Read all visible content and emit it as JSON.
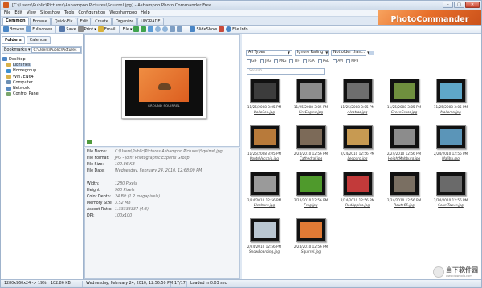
{
  "window": {
    "title": "[C:\\Users\\Public\\Pictures\\Ashampoo Pictures\\Squirrel.jpg] - Ashampoo Photo Commander Free",
    "controls": [
      "–",
      "□",
      "✕"
    ]
  },
  "menu": [
    "File",
    "Edit",
    "View",
    "Slideshow",
    "Tools",
    "Configuration",
    "Webshampoo",
    "Help"
  ],
  "logo_text": "PhotoCommander",
  "ribbon_tabs": [
    "Common",
    "Browse",
    "Quick-Fix",
    "Edit",
    "Create",
    "Organize",
    "UPGRADE"
  ],
  "toolbar": {
    "browse": "Browse",
    "fullscreen": "Fullscreen",
    "save": "Save",
    "print": "Print",
    "email": "Email",
    "file_menu": "File",
    "slideshow": "SlideShow",
    "file_info": "File Info"
  },
  "left_panel": {
    "tabs": [
      "Folders",
      "Calendar"
    ],
    "bookmarks_label": "Bookmarks",
    "path": "C:\\Users\\Public\\Pictures",
    "tree": [
      "Desktop",
      "Libraries",
      "Homegroup",
      "Win7EN64",
      "Computer",
      "Network",
      "Control Panel"
    ]
  },
  "preview": {
    "caption": "GROUND SQUIRREL"
  },
  "file_info": [
    {
      "key": "File Name:",
      "value": "C:\\Users\\Public\\Pictures\\Ashampoo Pictures\\Squirrel.jpg"
    },
    {
      "key": "File Format:",
      "value": "JPG - Joint Photographic Experts Group"
    },
    {
      "key": "File Size:",
      "value": "102.86 KB"
    },
    {
      "key": "File Date:",
      "value": "Wednesday, February 24, 2010, 12:68:00 PM"
    },
    {
      "key": "Width:",
      "value": "1280 Pixels"
    },
    {
      "key": "Height:",
      "value": "960 Pixels"
    },
    {
      "key": "Color Depth:",
      "value": "24 Bit (1.2 megapixels)"
    },
    {
      "key": "Memory Size:",
      "value": "3.52 MB"
    },
    {
      "key": "Aspect Ratio:",
      "value": "1.33333337 (4:3)"
    },
    {
      "key": "DPI:",
      "value": "100x100"
    }
  ],
  "filter": {
    "type": "All Types",
    "rating": "Ignore Rating",
    "age": "Not older than...",
    "formats": [
      "GIF",
      "JPG",
      "PNG",
      "TIF",
      "TGA",
      "PSD",
      "AVI",
      "MP3"
    ],
    "search_placeholder": "Search..."
  },
  "thumbnails": [
    {
      "date": "11/25/2008 3:05 PM",
      "name": "BolloSea.jpg",
      "color": "#3c3c3c"
    },
    {
      "date": "11/25/2008 3:05 PM",
      "name": "FireEngine.jpg",
      "color": "#8c8c8c"
    },
    {
      "date": "11/25/2008 3:05 PM",
      "name": "Alcatraz.jpg",
      "color": "#6e6e6e"
    },
    {
      "date": "11/25/2008 3:05 PM",
      "name": "GreenGrass.jpg",
      "color": "#6f8f3e"
    },
    {
      "date": "11/25/2008 3:05 PM",
      "name": "Mallorca.jpg",
      "color": "#5fa7c8"
    },
    {
      "date": "11/25/2008 3:05 PM",
      "name": "PonteVecchio.jpg",
      "color": "#b87a3a"
    },
    {
      "date": "2/24/2010 12:56 PM",
      "name": "Cathedral.jpg",
      "color": "#7c6a58"
    },
    {
      "date": "2/24/2010 12:56 PM",
      "name": "Leopard.jpg",
      "color": "#c79a52"
    },
    {
      "date": "2/24/2010 12:56 PM",
      "name": "HeightMahburg.jpg",
      "color": "#8c8c8c"
    },
    {
      "date": "2/24/2010 12:56 PM",
      "name": "Malibu.jpg",
      "color": "#5b95b8"
    },
    {
      "date": "2/24/2010 12:56 PM",
      "name": "Elephant.jpg",
      "color": "#9a9a9a"
    },
    {
      "date": "2/24/2010 12:56 PM",
      "name": "Frog.jpg",
      "color": "#4f9a2c"
    },
    {
      "date": "2/24/2010 12:56 PM",
      "name": "RedApples.jpg",
      "color": "#c23a3a"
    },
    {
      "date": "2/24/2010 12:56 PM",
      "name": "Route66.jpg",
      "color": "#7a6f62"
    },
    {
      "date": "2/24/2010 12:56 PM",
      "name": "SeamTower.jpg",
      "color": "#6a6a6a"
    },
    {
      "date": "2/24/2010 12:56 PM",
      "name": "SnowBoarding.jpg",
      "color": "#b9c6d1"
    },
    {
      "date": "2/24/2010 12:56 PM",
      "name": "Squirrel.jpg",
      "color": "#e07a35"
    }
  ],
  "status": [
    "1280x960x24 -> 19%",
    "102.86 KB",
    "Wednesday, February 24, 2010, 12:56:50 PM",
    "17/17",
    "Loaded in 0.03 sec"
  ],
  "watermark": {
    "text": "当下软件园",
    "sub": "www.downxia.com"
  },
  "colors": {
    "accent_orange": "#e86f2a",
    "chrome_blue": "#dfe8f3"
  }
}
